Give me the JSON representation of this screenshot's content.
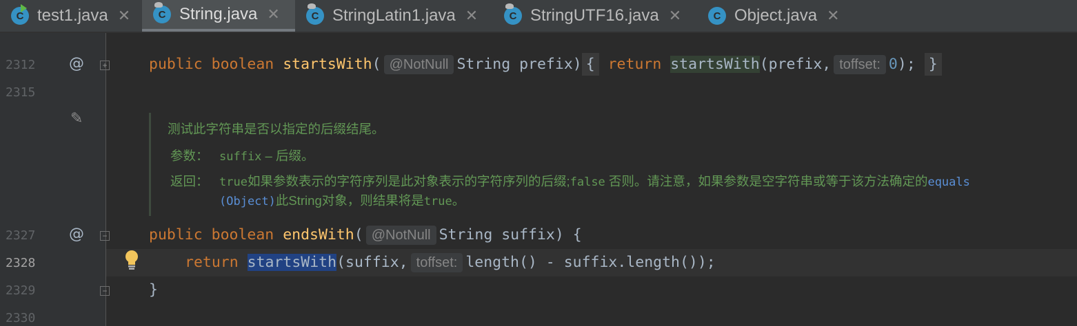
{
  "tabs": [
    {
      "label": "test1.java",
      "active": false,
      "icon": "java-class-run-icon"
    },
    {
      "label": "String.java",
      "active": true,
      "icon": "java-class-readonly-icon"
    },
    {
      "label": "StringLatin1.java",
      "active": false,
      "icon": "java-class-readonly-icon"
    },
    {
      "label": "StringUTF16.java",
      "active": false,
      "icon": "java-class-readonly-icon"
    },
    {
      "label": "Object.java",
      "active": false,
      "icon": "java-class-icon"
    }
  ],
  "icons": {
    "class_letter": "C",
    "close": "✕",
    "override": "@",
    "edit": "✎",
    "fold_plus": "+",
    "fold_minus": "−"
  },
  "lines": {
    "l1": "2312",
    "l2": "2315",
    "l3": "2327",
    "l4": "2328",
    "l5": "2329",
    "l6": "2330"
  },
  "code": {
    "starts": {
      "kw1": "public",
      "kw2": "boolean",
      "name": "startsWith",
      "open": "(",
      "hint_annotation": "@NotNull",
      "params": "String prefix)",
      "brace_open": "{",
      "kw_return": "return",
      "call": "startsWith",
      "args": "(prefix,",
      "hint_param": "toffset:",
      "num": "0",
      "tail": ");",
      "brace_close": "}"
    },
    "ends": {
      "kw1": "public",
      "kw2": "boolean",
      "name": "endsWith",
      "open": "(",
      "hint_annotation": "@NotNull",
      "params": "String suffix) {"
    },
    "body": {
      "kw_return": "return",
      "call": "startsWith",
      "args": "(suffix,",
      "hint_param": "toffset:",
      "rest": "length() - suffix.length());"
    },
    "close": "}"
  },
  "doc": {
    "summary": "测试此字符串是否以指定的后缀结尾。",
    "params_label": "参数：",
    "params_name": "suffix",
    "params_desc": " – 后缀。",
    "returns_label": "返回：",
    "r_true": "true",
    "r_text1": "如果参数表示的字符序列是此对象表示的字符序列的后缀;",
    "r_false": "false",
    "r_text2": " 否则。请注意，如果参数是空字符串或等于该方法确定的",
    "r_link1": "equals",
    "r_link2": "(Object)",
    "r_text3": "此",
    "r_string": "String",
    "r_text4": "对象，则结果将是",
    "r_true2": "true",
    "r_text5": "。"
  },
  "colors": {
    "background": "#2b2b2b",
    "keyword": "#cc7832",
    "method": "#ffc66d",
    "doc": "#629755",
    "selection": "#214283"
  }
}
